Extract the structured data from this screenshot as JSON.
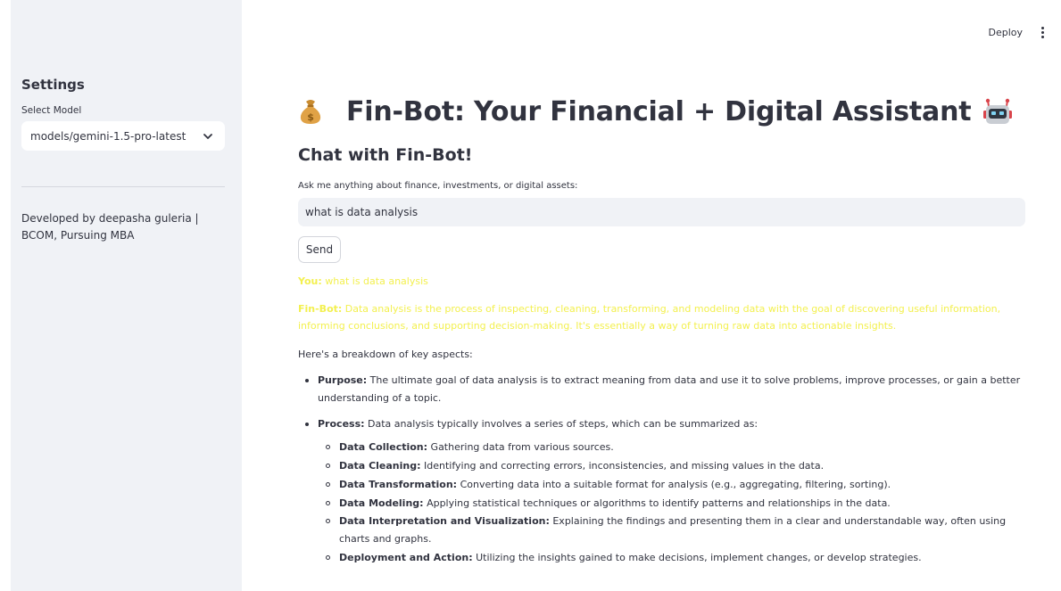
{
  "topbar": {
    "deploy_label": "Deploy"
  },
  "sidebar": {
    "title": "Settings",
    "select_label": "Select Model",
    "selected_model": "models/gemini-1.5-pro-latest",
    "credit": "Developed by deepasha guleria | BCOM, Pursuing MBA"
  },
  "main": {
    "title": "Fin-Bot: Your Financial + Digital Assistant",
    "subtitle": "Chat with Fin-Bot!",
    "input_label": "Ask me anything about finance, investments, or digital assets:",
    "input_value": "what is data analysis",
    "send_label": "Send",
    "you_prefix": "You:",
    "you_text": "what is data analysis",
    "bot_prefix": "Fin-Bot:",
    "bot_text": "Data analysis is the process of inspecting, cleaning, transforming, and modeling data with the goal of discovering useful information, informing conclusions, and supporting decision-making. It's essentially a way of turning raw data into actionable insights.",
    "breakdown_intro": "Here's a breakdown of key aspects:",
    "points": [
      {
        "term": "Purpose:",
        "text": "The ultimate goal of data analysis is to extract meaning from data and use it to solve problems, improve processes, or gain a better understanding of a topic."
      },
      {
        "term": "Process:",
        "text": "Data analysis typically involves a series of steps, which can be summarized as:"
      }
    ],
    "steps": [
      {
        "term": "Data Collection:",
        "text": "Gathering data from various sources."
      },
      {
        "term": "Data Cleaning:",
        "text": "Identifying and correcting errors, inconsistencies, and missing values in the data."
      },
      {
        "term": "Data Transformation:",
        "text": "Converting data into a suitable format for analysis (e.g., aggregating, filtering, sorting)."
      },
      {
        "term": "Data Modeling:",
        "text": "Applying statistical techniques or algorithms to identify patterns and relationships in the data."
      },
      {
        "term": "Data Interpretation and Visualization:",
        "text": "Explaining the findings and presenting them in a clear and understandable way, often using charts and graphs."
      },
      {
        "term": "Deployment and Action:",
        "text": "Utilizing the insights gained to make decisions, implement changes, or develop strategies."
      }
    ]
  },
  "colors": {
    "sidebar_bg": "#f0f2f6",
    "text": "#31333f",
    "highlight": "#f3f04f"
  },
  "icons": {
    "title_left": "money-bag-icon",
    "title_right": "robot-icon",
    "select_arrow": "chevron-down-icon",
    "menu": "kebab-menu-icon"
  }
}
